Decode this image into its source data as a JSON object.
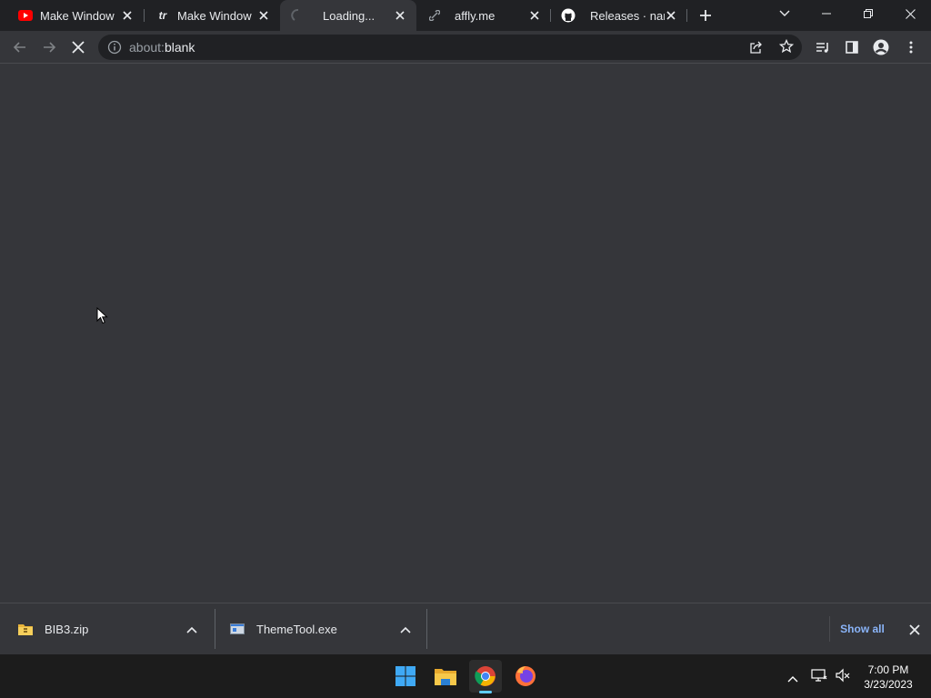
{
  "tabs": [
    {
      "title": "Make Windows",
      "icon": "youtube-icon"
    },
    {
      "title": "Make Windows",
      "icon": "tr-site-icon",
      "icon_text": "tr"
    },
    {
      "title": "Loading...",
      "icon": "loading-spinner-icon",
      "active": true
    },
    {
      "title": "affly.me",
      "icon": "link-icon"
    },
    {
      "title": "Releases · nama",
      "icon": "github-icon"
    }
  ],
  "toolbar": {
    "url_scheme": "about:",
    "url_path": "blank"
  },
  "downloads": [
    {
      "filename": "BIB3.zip",
      "icon": "zip-file-icon"
    },
    {
      "filename": "ThemeTool.exe",
      "icon": "exe-file-icon"
    }
  ],
  "download_bar": {
    "show_all_label": "Show all"
  },
  "taskbar": {
    "time": "7:00 PM",
    "date": "3/23/2023",
    "apps": [
      "windows-start-icon",
      "file-explorer-icon",
      "chrome-icon",
      "firefox-icon"
    ]
  },
  "colors": {
    "tabstrip_bg": "#202124",
    "page_bg": "#35363a",
    "accent_link": "#8ab4f8",
    "taskbar_bg": "#1c1c1c"
  }
}
